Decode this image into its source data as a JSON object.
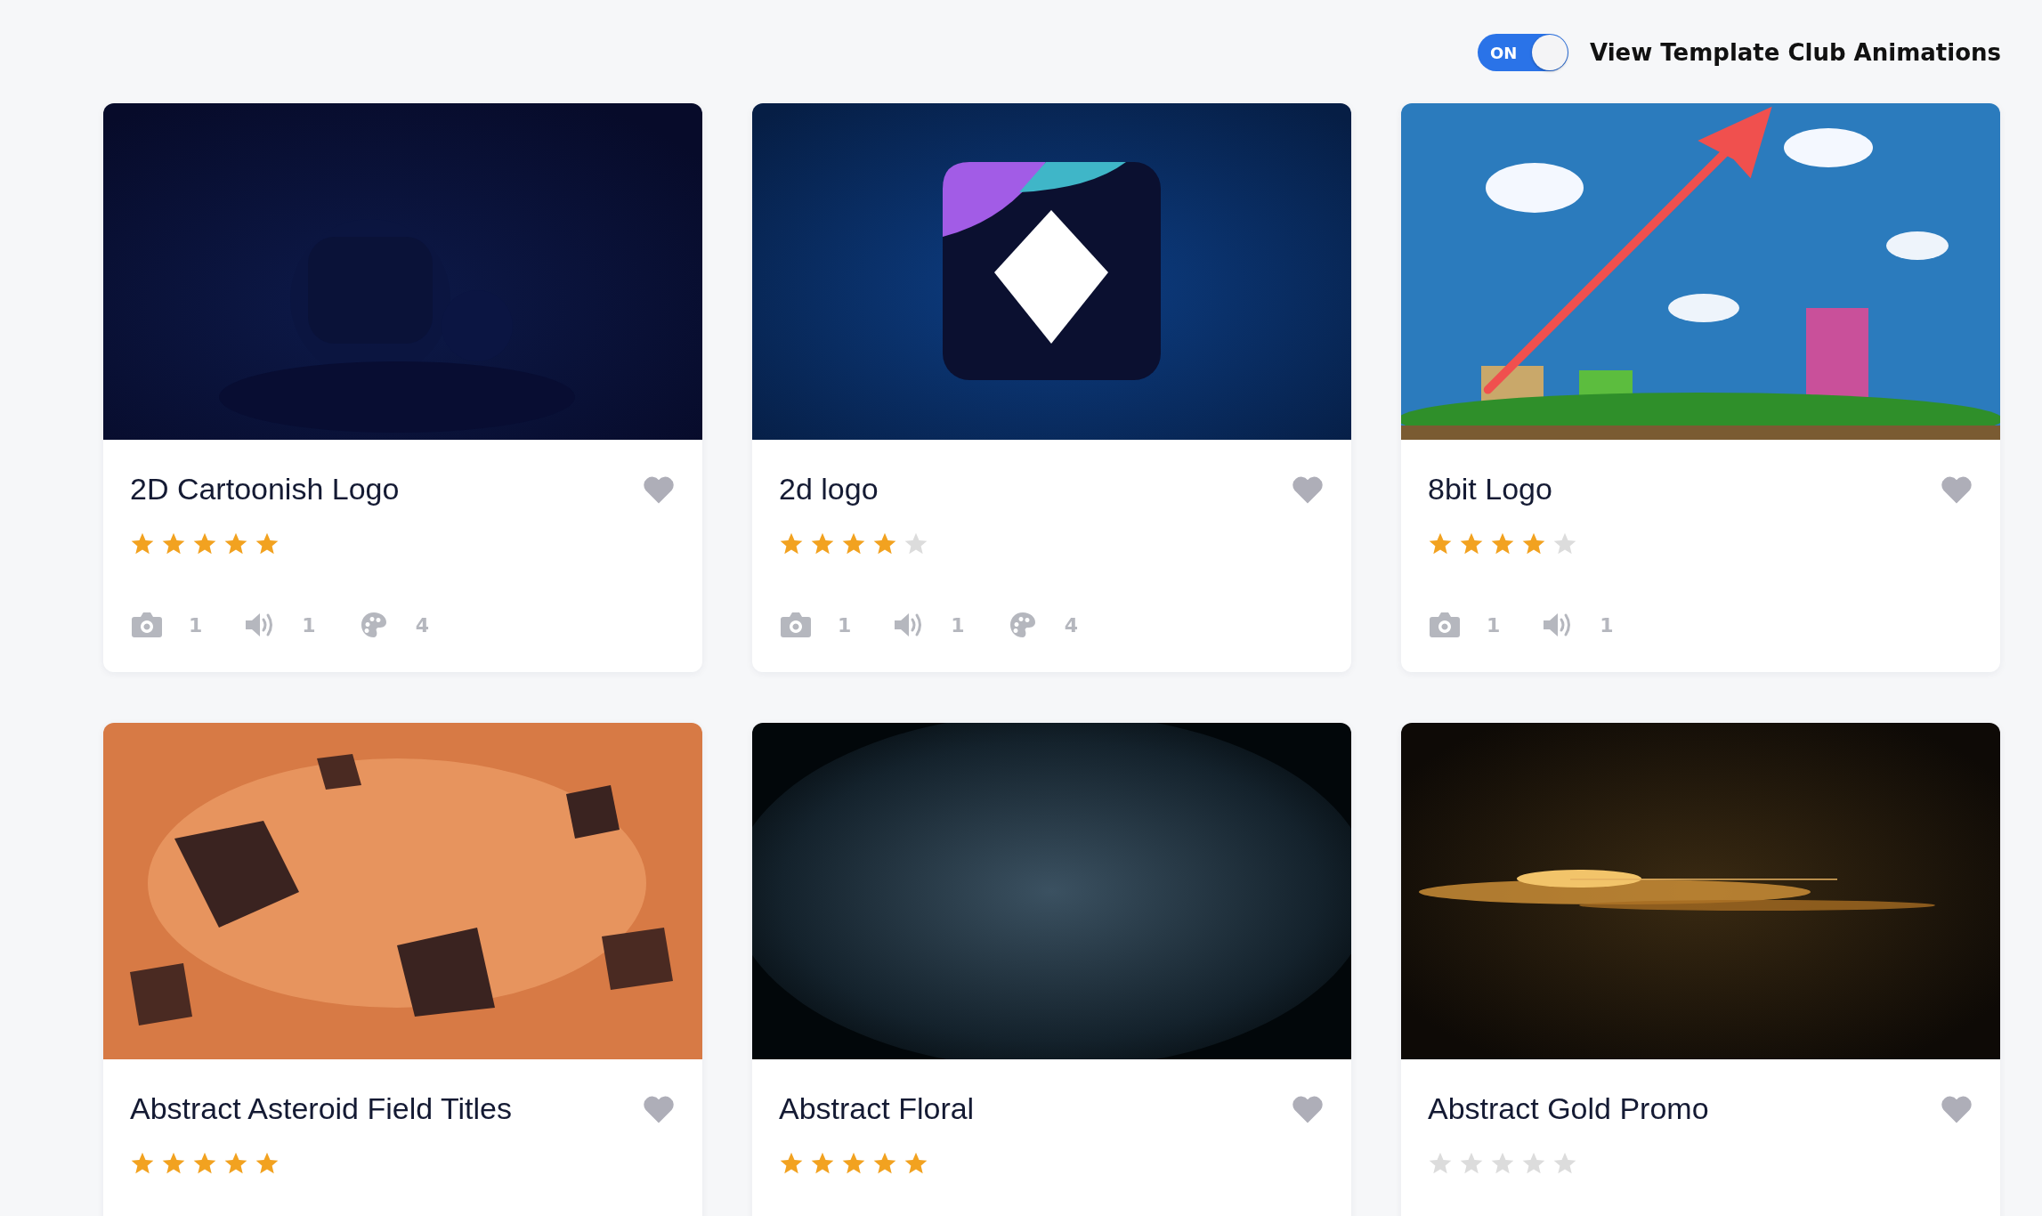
{
  "toggle": {
    "label": "ON",
    "on": true,
    "caption": "View Template Club Animations"
  },
  "cards": [
    {
      "thumbnail": {
        "kind": "picture"
      },
      "title": "2D Cartoonish Logo",
      "favorite": false,
      "stars": 5,
      "meta": [
        {
          "kind": "camera",
          "count": "1"
        },
        {
          "kind": "audio",
          "count": "1"
        },
        {
          "kind": "palette",
          "count": "4"
        }
      ]
    },
    {
      "thumbnail": {
        "kind": "picture"
      },
      "title": "2d logo",
      "favorite": false,
      "stars": 4,
      "meta": [
        {
          "kind": "camera",
          "count": "1"
        },
        {
          "kind": "audio",
          "count": "1"
        },
        {
          "kind": "palette",
          "count": "4"
        }
      ]
    },
    {
      "thumbnail": {
        "kind": "picture"
      },
      "title": "8bit Logo",
      "favorite": false,
      "stars": 4,
      "meta": [
        {
          "kind": "camera",
          "count": "1"
        },
        {
          "kind": "audio",
          "count": "1"
        }
      ]
    },
    {
      "thumbnail": {
        "kind": "picture"
      },
      "title": "Abstract Asteroid Field Titles",
      "favorite": false,
      "stars": 5
    },
    {
      "thumbnail": {
        "kind": "picture"
      },
      "title": "Abstract Floral",
      "favorite": false,
      "stars": 5
    },
    {
      "thumbnail": {
        "kind": "picture"
      },
      "title": "Abstract Gold Promo",
      "favorite": false,
      "stars": 0
    }
  ],
  "annotation": {
    "kind": "arrow"
  }
}
